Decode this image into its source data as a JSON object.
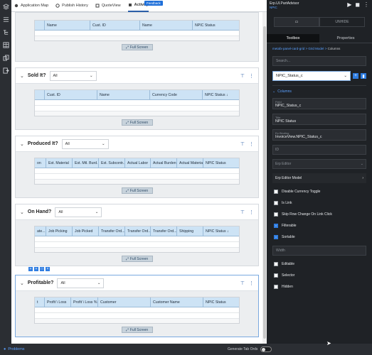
{
  "canvas": {
    "feedback_label": "Feedback",
    "tabs": [
      {
        "label": "Application Map",
        "icon": "map-icon"
      },
      {
        "label": "Publish History",
        "icon": "history-icon"
      },
      {
        "label": "QuoteView",
        "icon": "view-icon"
      },
      {
        "label": "Activity",
        "icon": "activity-icon"
      }
    ],
    "fullscreen_label": "Full Screen",
    "top_grid": {
      "columns": [
        "Name",
        "Cust. ID",
        "Name",
        "NPIC Status"
      ]
    },
    "sections": [
      {
        "title": "Sold It?",
        "filter": "All",
        "columns": [
          "Cust. ID",
          "Name",
          "Currency Code",
          "NPIC Status ↓"
        ]
      },
      {
        "title": "Produced It?",
        "filter": "All",
        "columns": [
          "on",
          "Est. Material",
          "Est. Mtl. Burd...",
          "Est. Subcontr...",
          "Actual Labor",
          "Actual Burden",
          "Actual Material",
          "NPIC Status"
        ]
      },
      {
        "title": "On Hand?",
        "filter": "All",
        "columns": [
          "ate...",
          "Job Picking",
          "Job Picked",
          "Transfer Ord...",
          "Transfer Ord...",
          "Transfer Ord...",
          "Shipping",
          "NPIC Status ↓"
        ]
      },
      {
        "title": "Profitable?",
        "filter": "All",
        "columns": [
          "t",
          "Profit \\ Loss",
          "Profit \\ Loss %",
          "Customer",
          "Customer Name",
          "NPIC Status"
        ]
      }
    ]
  },
  "panel": {
    "app_title": "Erp.UI.PartAdvisor",
    "app_subtitle": "NPIC",
    "seg_right": "UNHIDE",
    "tabs": [
      "Toolbox",
      "Properties"
    ],
    "breadcrumb": [
      "metafx-panel-card-grid",
      "Grid Model",
      "Columns"
    ],
    "search_placeholder": "Search...",
    "selected_column": "NPIC_Status_c",
    "columns_section": "Columns",
    "field_label": "Field",
    "field_value": "NPIC_Status_c",
    "title_label": "Title",
    "title_value": "NPIC Status",
    "ep_label": "Ep Binding",
    "ep_value": "InvoiceView.NPIC_Status_c",
    "id_label": "ID",
    "erp_editor_label": "Erp Editor",
    "erp_editor_model_label": "Erp Editor Model",
    "checks": [
      {
        "label": "Disable Currency Toggle",
        "checked": false
      },
      {
        "label": "Is Link",
        "checked": false
      },
      {
        "label": "Skip Row Change On Link Click",
        "checked": false
      },
      {
        "label": "Filterable",
        "checked": true
      },
      {
        "label": "Sortable",
        "checked": true
      }
    ],
    "width_label": "Width",
    "checks2": [
      {
        "label": "Editable",
        "checked": false
      },
      {
        "label": "Selector",
        "checked": false
      },
      {
        "label": "Hidden",
        "checked": false
      }
    ]
  },
  "bottombar": {
    "problems_label": "Problems",
    "generate_label": "Generate Tab Ords"
  }
}
